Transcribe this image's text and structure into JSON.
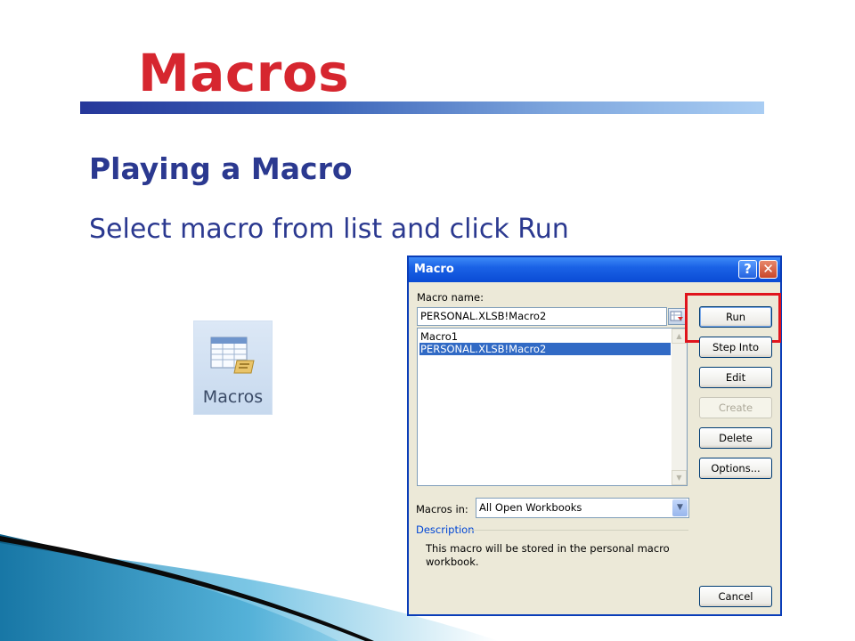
{
  "slide": {
    "title": "Macros",
    "heading": "Playing a Macro",
    "body": "Select macro from list and click Run"
  },
  "ribbon": {
    "label": "Macros",
    "icon": "macros-icon"
  },
  "dialog": {
    "title": "Macro",
    "help_symbol": "?",
    "close_symbol": "✕",
    "macro_name_label": "Macro name:",
    "macro_name_value": "PERSONAL.XLSB!Macro2",
    "macros": [
      "Macro1",
      "PERSONAL.XLSB!Macro2"
    ],
    "selected_macro": "PERSONAL.XLSB!Macro2",
    "buttons": {
      "run": "Run",
      "step_into": "Step Into",
      "edit": "Edit",
      "create": "Create",
      "delete": "Delete",
      "options": "Options...",
      "cancel": "Cancel"
    },
    "macros_in_label": "Macros in:",
    "macros_in_value": "All Open Workbooks",
    "description_label": "Description",
    "description_text": "This macro will be stored in the personal macro workbook."
  },
  "colors": {
    "title": "#d6262f",
    "heading": "#2b3990",
    "highlight": "#e0141c",
    "selection": "#316ac5"
  }
}
